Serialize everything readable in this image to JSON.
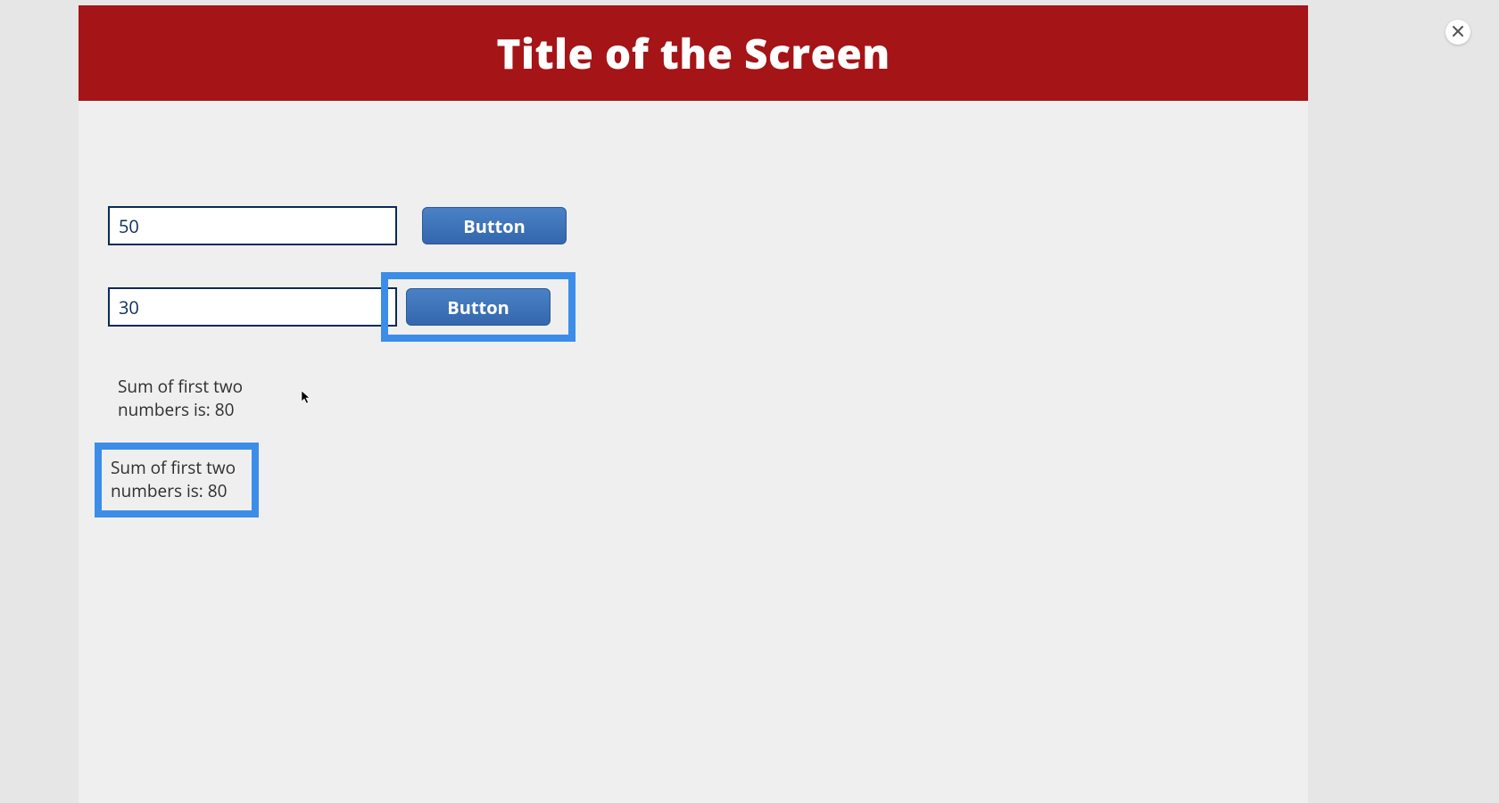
{
  "header": {
    "title": "Title of the Screen"
  },
  "inputs": {
    "field1_value": "50",
    "field2_value": "30"
  },
  "buttons": {
    "btn1_label": "Button",
    "btn2_label": "Button"
  },
  "results": {
    "line1": "Sum of first two numbers is: 80",
    "line2": "Sum of first two numbers is: 80"
  }
}
